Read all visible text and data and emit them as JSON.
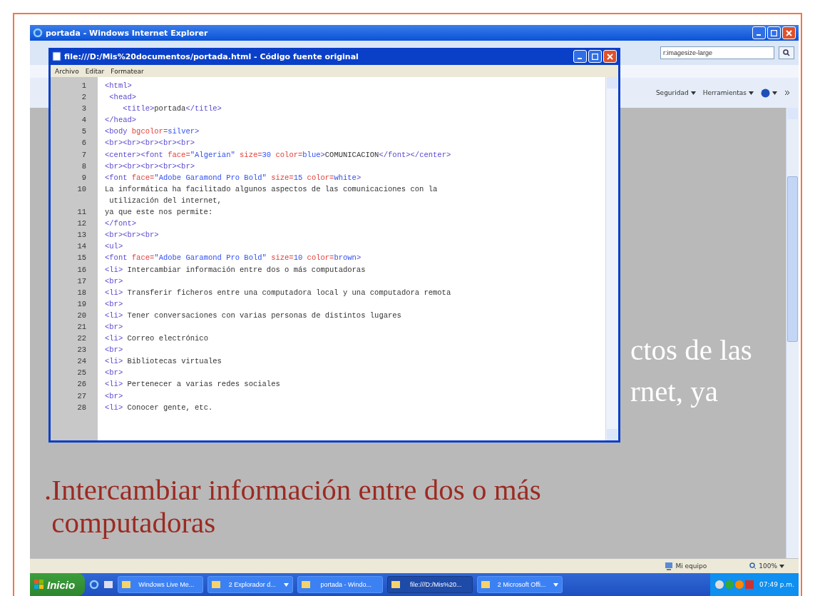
{
  "ie_window": {
    "title": "portada - Windows Internet Explorer",
    "search_field": {
      "value": "r:imagesize-large"
    },
    "command_bar": [
      "Seguridad",
      "Herramientas"
    ],
    "page": {
      "fragments": [
        "ctos de las",
        "rnet, ya"
      ],
      "list_item": {
        "bullet": ".",
        "lines": [
          "Intercambiar información entre dos o más",
          "computadoras"
        ]
      }
    },
    "status_bar": {
      "zone": "Mi equipo",
      "zoom": "100%"
    }
  },
  "source_window": {
    "title": "file:///D:/Mis%20documentos/portada.html - Código fuente original",
    "menu": [
      "Archivo",
      "Editar",
      "Formatear"
    ],
    "lines": [
      {
        "number": "1",
        "parts": [
          {
            "kind": "tag",
            "text": "<html>"
          }
        ]
      },
      {
        "number": "2",
        "parts": [
          {
            "kind": "tag",
            "text": " <head>"
          }
        ]
      },
      {
        "number": "3",
        "parts": [
          {
            "kind": "tag",
            "text": "    <title>"
          },
          {
            "kind": "text",
            "text": "portada"
          },
          {
            "kind": "tag",
            "text": "</title>"
          }
        ]
      },
      {
        "number": "4",
        "parts": [
          {
            "kind": "tag",
            "text": "</head>"
          }
        ]
      },
      {
        "number": "5",
        "parts": [
          {
            "kind": "tag",
            "text": "<body "
          },
          {
            "kind": "attr",
            "text": "bgcolor="
          },
          {
            "kind": "value",
            "text": "silver"
          },
          {
            "kind": "tag",
            "text": ">"
          }
        ]
      },
      {
        "number": "6",
        "parts": [
          {
            "kind": "tag",
            "text": "<br><br><br><br><br>"
          }
        ]
      },
      {
        "number": "7",
        "parts": [
          {
            "kind": "tag",
            "text": "<center><font "
          },
          {
            "kind": "attr",
            "text": "face="
          },
          {
            "kind": "value",
            "text": "\"Algerian\""
          },
          {
            "kind": "attr",
            "text": " size="
          },
          {
            "kind": "value",
            "text": "30"
          },
          {
            "kind": "attr",
            "text": " color="
          },
          {
            "kind": "value",
            "text": "blue"
          },
          {
            "kind": "tag",
            "text": ">"
          },
          {
            "kind": "text",
            "text": "COMUNICACION"
          },
          {
            "kind": "tag",
            "text": "</font></center>"
          }
        ]
      },
      {
        "number": "8",
        "parts": [
          {
            "kind": "tag",
            "text": "<br><br><br><br><br>"
          }
        ]
      },
      {
        "number": "9",
        "parts": [
          {
            "kind": "tag",
            "text": "<font "
          },
          {
            "kind": "attr",
            "text": "face="
          },
          {
            "kind": "value",
            "text": "\"Adobe Garamond Pro Bold\""
          },
          {
            "kind": "attr",
            "text": " size="
          },
          {
            "kind": "value",
            "text": "15"
          },
          {
            "kind": "attr",
            "text": " color="
          },
          {
            "kind": "value",
            "text": "white"
          },
          {
            "kind": "tag",
            "text": ">"
          }
        ]
      },
      {
        "number": "10",
        "parts": [
          {
            "kind": "text",
            "text": "La informática ha facilitado algunos aspectos de las comunicaciones con la"
          }
        ],
        "continuation": " utilización del internet,"
      },
      {
        "number": "11",
        "parts": [
          {
            "kind": "text",
            "text": "ya que este nos permite:"
          }
        ]
      },
      {
        "number": "12",
        "parts": [
          {
            "kind": "tag",
            "text": "</font>"
          }
        ]
      },
      {
        "number": "13",
        "parts": [
          {
            "kind": "tag",
            "text": "<br><br><br>"
          }
        ]
      },
      {
        "number": "14",
        "parts": [
          {
            "kind": "tag",
            "text": "<ul>"
          }
        ]
      },
      {
        "number": "15",
        "parts": [
          {
            "kind": "tag",
            "text": "<font "
          },
          {
            "kind": "attr",
            "text": "face="
          },
          {
            "kind": "value",
            "text": "\"Adobe Garamond Pro Bold\""
          },
          {
            "kind": "attr",
            "text": " size="
          },
          {
            "kind": "value",
            "text": "10"
          },
          {
            "kind": "attr",
            "text": " color="
          },
          {
            "kind": "value",
            "text": "brown"
          },
          {
            "kind": "tag",
            "text": ">"
          }
        ]
      },
      {
        "number": "16",
        "parts": [
          {
            "kind": "tag",
            "text": "<li>"
          },
          {
            "kind": "text",
            "text": " Intercambiar información entre dos o más computadoras"
          }
        ]
      },
      {
        "number": "17",
        "parts": [
          {
            "kind": "tag",
            "text": "<br>"
          }
        ]
      },
      {
        "number": "18",
        "parts": [
          {
            "kind": "tag",
            "text": "<li>"
          },
          {
            "kind": "text",
            "text": " Transferir ficheros entre una computadora local y una computadora remota"
          }
        ]
      },
      {
        "number": "19",
        "parts": [
          {
            "kind": "tag",
            "text": "<br>"
          }
        ]
      },
      {
        "number": "20",
        "parts": [
          {
            "kind": "tag",
            "text": "<li>"
          },
          {
            "kind": "text",
            "text": " Tener conversaciones con varias personas de distintos lugares"
          }
        ]
      },
      {
        "number": "21",
        "parts": [
          {
            "kind": "tag",
            "text": "<br>"
          }
        ]
      },
      {
        "number": "22",
        "parts": [
          {
            "kind": "tag",
            "text": "<li>"
          },
          {
            "kind": "text",
            "text": " Correo electrónico"
          }
        ]
      },
      {
        "number": "23",
        "parts": [
          {
            "kind": "tag",
            "text": "<br>"
          }
        ]
      },
      {
        "number": "24",
        "parts": [
          {
            "kind": "tag",
            "text": "<li>"
          },
          {
            "kind": "text",
            "text": " Bibliotecas virtuales"
          }
        ]
      },
      {
        "number": "25",
        "parts": [
          {
            "kind": "tag",
            "text": "<br>"
          }
        ]
      },
      {
        "number": "26",
        "parts": [
          {
            "kind": "tag",
            "text": "<li>"
          },
          {
            "kind": "text",
            "text": " Pertenecer a varias redes sociales"
          }
        ]
      },
      {
        "number": "27",
        "parts": [
          {
            "kind": "tag",
            "text": "<br>"
          }
        ]
      },
      {
        "number": "28",
        "parts": [
          {
            "kind": "tag",
            "text": "<li>"
          },
          {
            "kind": "text",
            "text": " Conocer gente, etc."
          }
        ]
      }
    ]
  },
  "taskbar": {
    "start": "Inicio",
    "tasks": [
      {
        "label": "Windows Live Me...",
        "selected": false,
        "grouped": false
      },
      {
        "label": "2 Explorador d...",
        "selected": false,
        "grouped": true
      },
      {
        "label": "portada - Windo...",
        "selected": false,
        "grouped": false
      },
      {
        "label": "file:///D:/Mis%20...",
        "selected": true,
        "grouped": false
      },
      {
        "label": "2 Microsoft Offi...",
        "selected": false,
        "grouped": true
      }
    ],
    "clock": "07:49 p.m."
  }
}
